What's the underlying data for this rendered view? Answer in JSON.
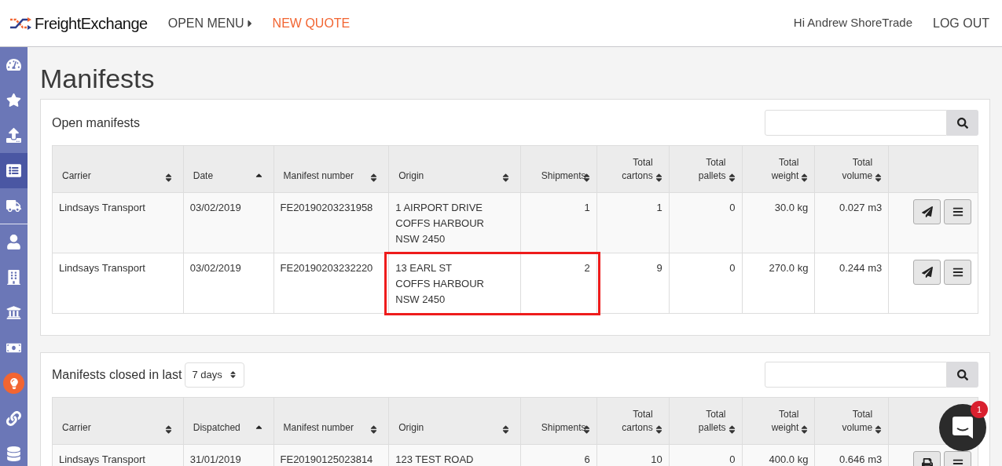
{
  "header": {
    "brand": "FreightExchange",
    "nav": [
      {
        "label": "OPEN MENU",
        "kind": "menu"
      },
      {
        "label": "NEW QUOTE",
        "kind": "accent"
      }
    ],
    "greeting": "Hi Andrew ShoreTrade",
    "logout": "LOG OUT"
  },
  "sidebar": {
    "groups": [
      [
        {
          "kind": "gauge",
          "selected": false,
          "highlighted": false
        },
        {
          "kind": "star",
          "selected": false,
          "highlighted": false
        },
        {
          "kind": "upload",
          "selected": false,
          "highlighted": false
        },
        {
          "kind": "list",
          "selected": true,
          "highlighted": false
        },
        {
          "kind": "truck",
          "selected": false,
          "highlighted": false
        }
      ],
      [
        {
          "kind": "user",
          "selected": false,
          "highlighted": false
        },
        {
          "kind": "building",
          "selected": false,
          "highlighted": false
        },
        {
          "kind": "bank",
          "selected": false,
          "highlighted": false
        },
        {
          "kind": "money",
          "selected": false,
          "highlighted": false
        },
        {
          "kind": "lightbulb",
          "selected": false,
          "highlighted": true
        },
        {
          "kind": "link",
          "selected": false,
          "highlighted": false
        },
        {
          "kind": "database",
          "selected": false,
          "highlighted": false
        }
      ]
    ]
  },
  "page_title": "Manifests",
  "panels": [
    {
      "kind": "open",
      "title": "Open manifests",
      "columns": [
        {
          "label": "Carrier",
          "sorted": false
        },
        {
          "label": "Date",
          "sorted": true
        },
        {
          "label": "Manifest number",
          "sorted": false
        },
        {
          "label": "Origin",
          "sorted": false
        },
        {
          "label": "Shipments",
          "sorted": false
        },
        {
          "label": "Total cartons",
          "sorted": false
        },
        {
          "label": "Total pallets",
          "sorted": false
        },
        {
          "label": "Total weight",
          "sorted": false
        },
        {
          "label": "Total volume",
          "sorted": false
        }
      ],
      "rows": [
        {
          "carrier": "Lindsays Transport",
          "date": "03/02/2019",
          "manifest_number": "FE20190203231958",
          "origin": [
            "1 AIRPORT DRIVE",
            "COFFS HARBOUR",
            "NSW 2450"
          ],
          "shipments": "1",
          "cartons": "1",
          "pallets": "0",
          "weight": "30.0 kg",
          "volume": "0.027 m3",
          "highlighted": false
        },
        {
          "carrier": "Lindsays Transport",
          "date": "03/02/2019",
          "manifest_number": "FE20190203232220",
          "origin": [
            "13 EARL ST",
            "COFFS HARBOUR",
            "NSW 2450"
          ],
          "shipments": "2",
          "cartons": "9",
          "pallets": "0",
          "weight": "270.0 kg",
          "volume": "0.244 m3",
          "highlighted": true
        }
      ]
    },
    {
      "kind": "closed",
      "title": "Manifests closed in last",
      "select": {
        "value": "7 days"
      },
      "columns": [
        {
          "label": "Carrier",
          "sorted": false
        },
        {
          "label": "Dispatched",
          "sorted": true
        },
        {
          "label": "Manifest number",
          "sorted": false
        },
        {
          "label": "Origin",
          "sorted": false
        },
        {
          "label": "Shipments",
          "sorted": false
        },
        {
          "label": "Total cartons",
          "sorted": false
        },
        {
          "label": "Total pallets",
          "sorted": false
        },
        {
          "label": "Total weight",
          "sorted": false
        },
        {
          "label": "Total volume",
          "sorted": false
        }
      ],
      "rows": [
        {
          "carrier": "Lindsays Transport",
          "date": "31/01/2019",
          "manifest_number": "FE20190125023814",
          "origin": [
            "123 TEST ROAD"
          ],
          "shipments": "6",
          "cartons": "10",
          "pallets": "0",
          "weight": "400.0 kg",
          "volume": "0.646 m3",
          "highlighted": false
        }
      ]
    }
  ],
  "chat": {
    "badge": "1"
  }
}
